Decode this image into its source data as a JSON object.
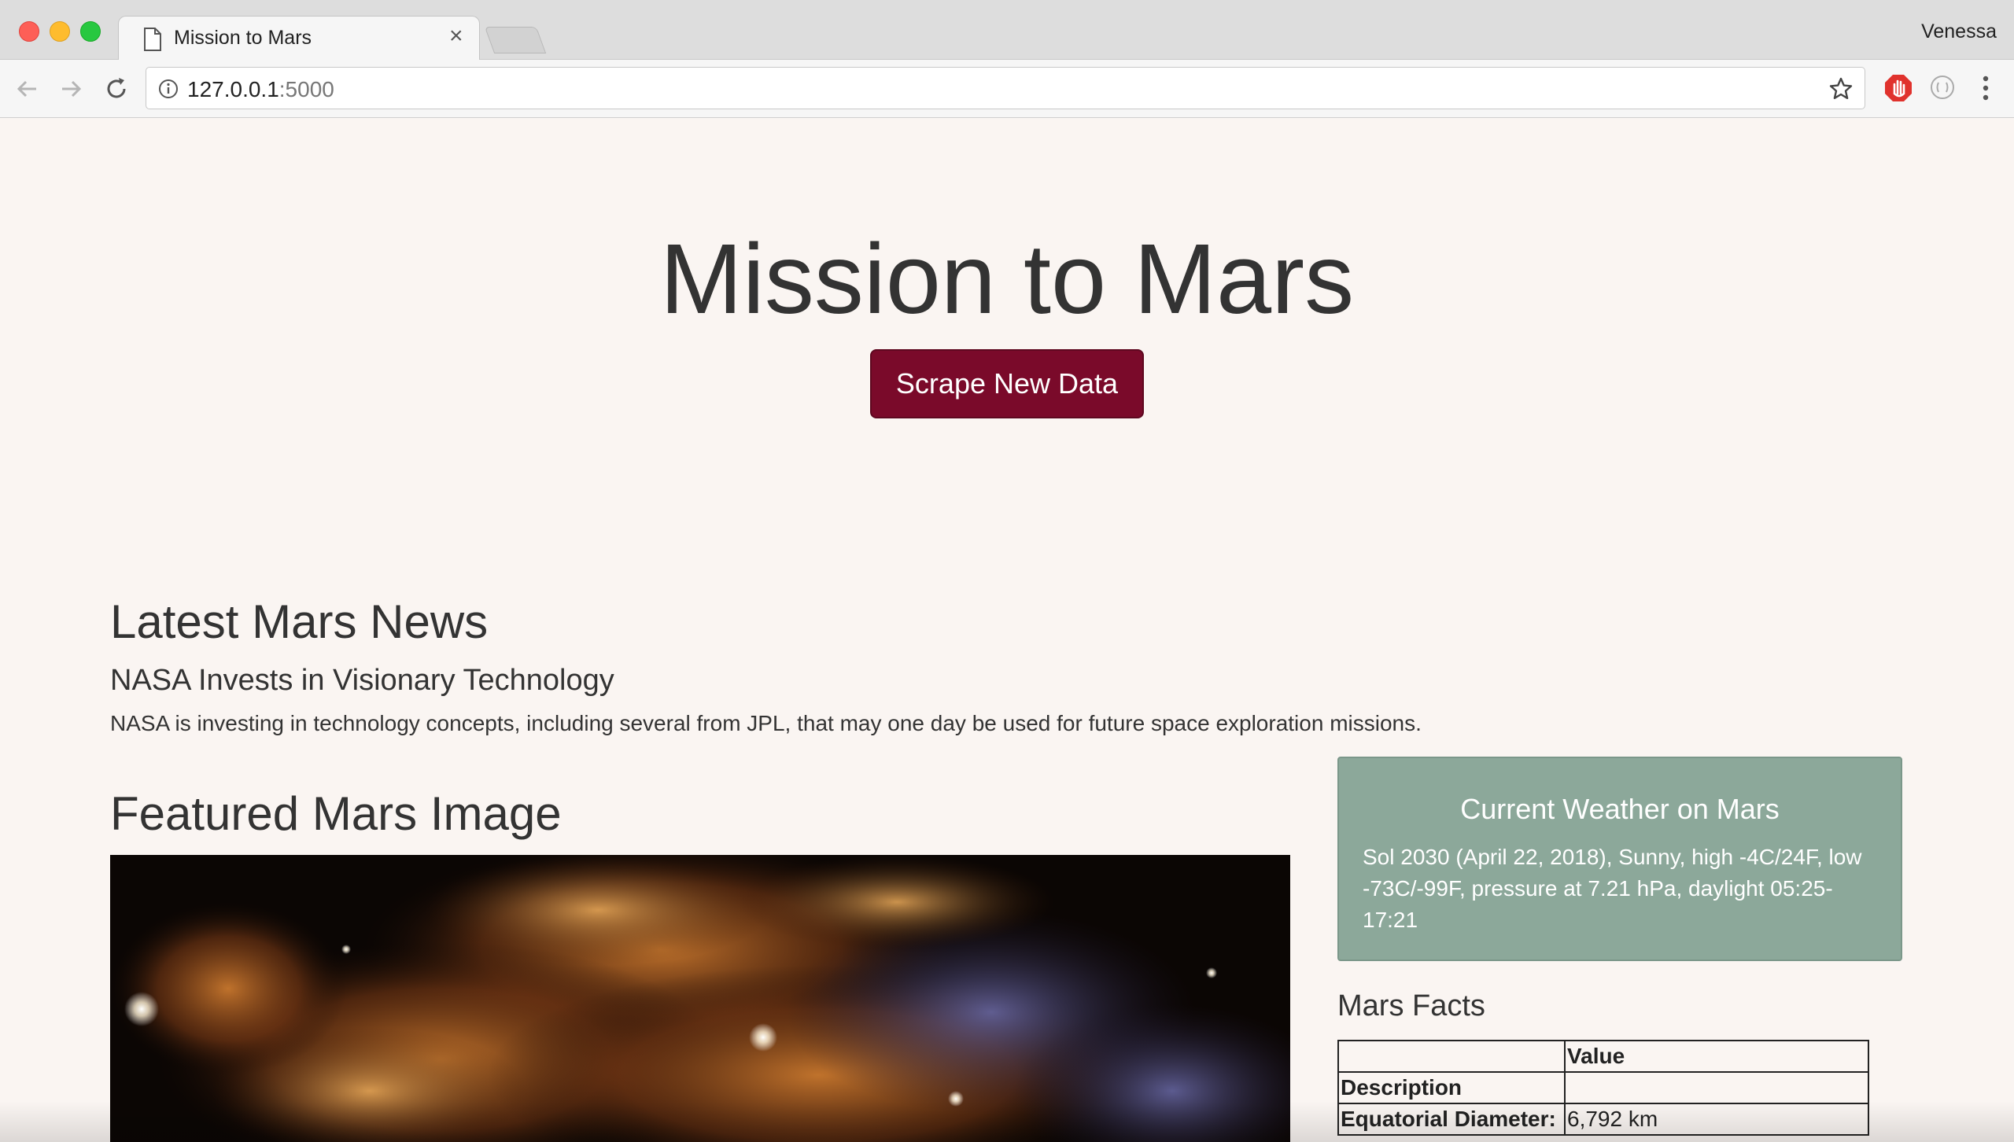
{
  "browser": {
    "tab_title": "Mission to Mars",
    "tab_close": "×",
    "profile_name": "Venessa",
    "url_host": "127.0.0.1",
    "url_port": ":5000"
  },
  "page": {
    "title": "Mission to Mars",
    "scrape_button": "Scrape New Data",
    "news": {
      "heading": "Latest Mars News",
      "title": "NASA Invests in Visionary Technology",
      "body": "NASA is investing in technology concepts, including several from JPL, that may one day be used for future space exploration missions."
    },
    "featured_image": {
      "heading": "Featured Mars Image"
    },
    "weather": {
      "heading": "Current Weather on Mars",
      "text": "Sol 2030 (April 22, 2018), Sunny, high -4C/24F, low -73C/-99F, pressure at 7.21 hPa, daylight 05:25-17:21"
    },
    "facts": {
      "heading": "Mars Facts",
      "columns": [
        "",
        "Value"
      ],
      "rows": [
        {
          "label": "Description",
          "value": ""
        },
        {
          "label": "Equatorial Diameter:",
          "value": "6,792 km"
        }
      ]
    }
  },
  "colors": {
    "page_background": "#faf5f2",
    "button": "#7a0a2a",
    "weather_panel": "#8ca89a"
  },
  "icons": [
    "document-icon",
    "back-arrow-icon",
    "forward-arrow-icon",
    "reload-icon",
    "info-icon",
    "star-icon",
    "adblock-icon",
    "extension-icon",
    "menu-icon"
  ]
}
